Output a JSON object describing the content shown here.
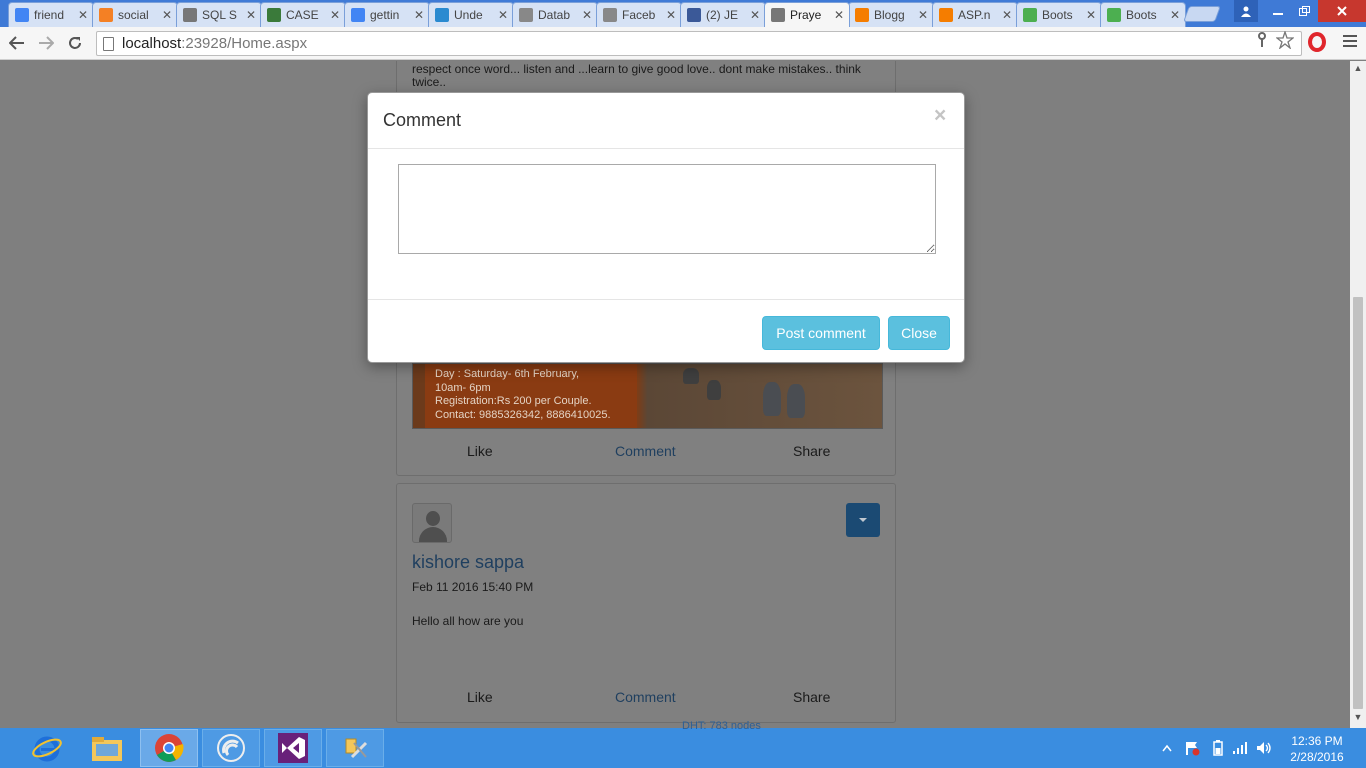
{
  "browser": {
    "tabs": [
      {
        "title": "friend",
        "favicon": "google-icon",
        "color": "#4285f4"
      },
      {
        "title": "social",
        "favicon": "stackoverflow-icon",
        "color": "#f48024"
      },
      {
        "title": "SQL S",
        "favicon": "page-icon",
        "color": "#777777"
      },
      {
        "title": "CASE",
        "favicon": "sql-icon",
        "color": "#3a7a3a"
      },
      {
        "title": "gettin",
        "favicon": "google-icon",
        "color": "#4285f4"
      },
      {
        "title": "Unde",
        "favicon": "d-icon",
        "color": "#2a8ad0"
      },
      {
        "title": "Datab",
        "favicon": "egg-icon",
        "color": "#888888"
      },
      {
        "title": "Faceb",
        "favicon": "egg-icon",
        "color": "#888888"
      },
      {
        "title": "(2) JE",
        "favicon": "facebook-icon",
        "color": "#3b5998"
      },
      {
        "title": "Praye",
        "favicon": "page-icon",
        "color": "#777777",
        "active": true
      },
      {
        "title": "Blogg",
        "favicon": "blogger-icon",
        "color": "#f57d00"
      },
      {
        "title": "ASP.n",
        "favicon": "blogger-icon",
        "color": "#f57d00"
      },
      {
        "title": "Boots",
        "favicon": "w3-icon",
        "color": "#4caf50"
      },
      {
        "title": "Boots",
        "favicon": "w3-icon",
        "color": "#4caf50"
      }
    ],
    "url_host": "localhost",
    "url_path": ":23928/Home.aspx"
  },
  "post1": {
    "text": "respect once word... listen and ...learn to give good love.. dont make mistakes.. think twice..",
    "event_day": "Day    : Saturday- 6th February,",
    "event_time": "10am- 6pm",
    "event_reg": "Registration:Rs 200 per Couple.",
    "event_contact": "Contact: 9885326342, 8886410025."
  },
  "actions": {
    "like": "Like",
    "comment": "Comment",
    "share": "Share"
  },
  "post2": {
    "author": "kishore sappa",
    "date": "Feb 11 2016 15:40 PM",
    "body": "Hello all how are you"
  },
  "modal": {
    "title": "Comment",
    "close_symbol": "×",
    "comment_value": "",
    "post_label": "Post comment",
    "close_label": "Close"
  },
  "taskbar": {
    "apps": [
      "ie-icon",
      "file-explorer-icon",
      "chrome-icon",
      "bittorrent-icon",
      "visual-studio-icon",
      "tools-icon"
    ],
    "time": "12:36 PM",
    "date": "2/28/2016"
  },
  "colors": {
    "accent": "#5bc0de",
    "tabbar": "#3f7ad6",
    "taskbar": "#3a8de0"
  }
}
